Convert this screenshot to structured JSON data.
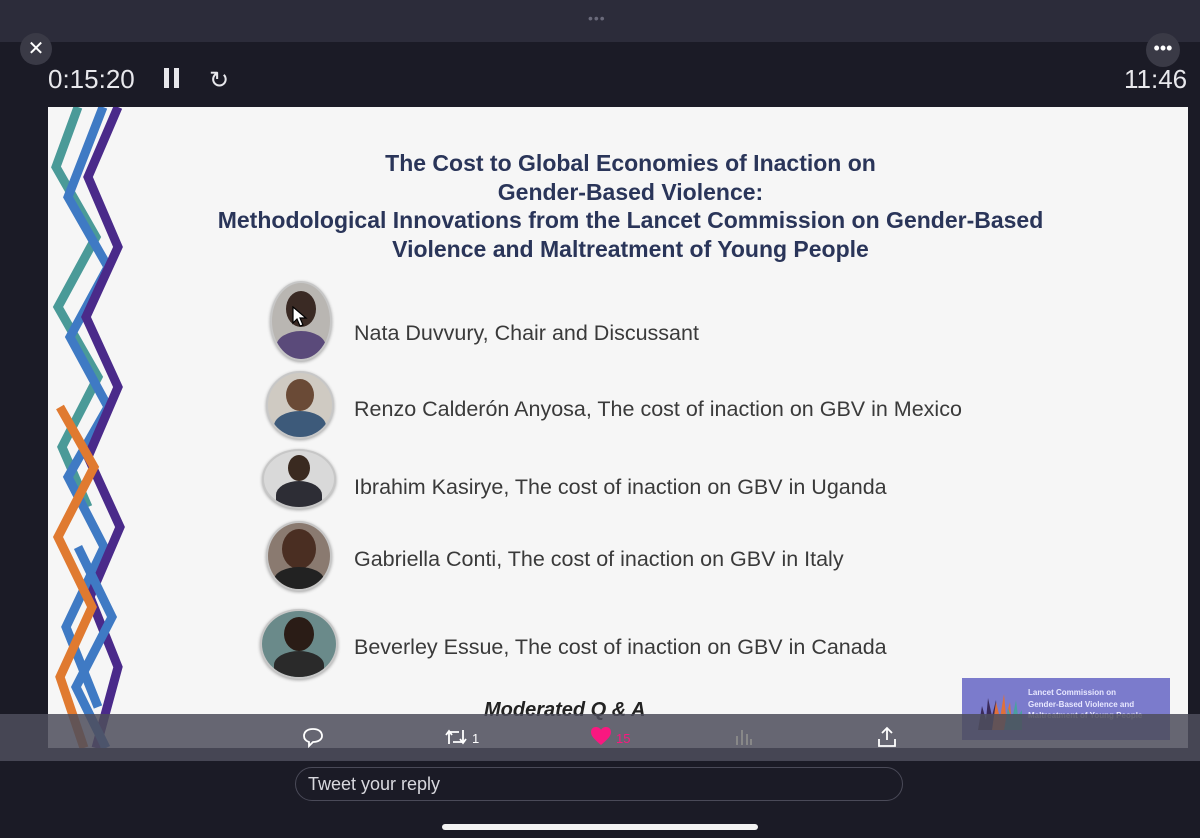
{
  "player": {
    "elapsed": "0:15:20",
    "duration": "11:46",
    "close_icon": "close-icon",
    "more_icon": "more-horizontal-icon",
    "pause_icon": "pause-icon",
    "replay_icon": "replay-icon"
  },
  "slide": {
    "title_lines": [
      "The Cost to Global Economies of Inaction on",
      "Gender-Based Violence:",
      "Methodological Innovations from the Lancet Commission on Gender-Based",
      "Violence and Maltreatment of Young People"
    ],
    "speakers": [
      {
        "text": "Nata Duvvury, Chair and Discussant"
      },
      {
        "text": "Renzo Calderón Anyosa, The cost of inaction on GBV in Mexico"
      },
      {
        "text": "Ibrahim Kasirye, The cost of inaction on GBV in Uganda"
      },
      {
        "text": "Gabriella Conti, The cost of inaction on GBV in Italy"
      },
      {
        "text": "Beverley Essue, The cost of inaction on GBV in Canada"
      }
    ],
    "moderated": "Moderated Q & A",
    "logo": {
      "lines": [
        "Lancet Commission on",
        "Gender-Based Violence and",
        "Maltreatment of Young People"
      ],
      "color": "#7b7bcc"
    },
    "title_color": "#2a3559"
  },
  "actions": {
    "reply_icon": "reply-icon",
    "retweet_icon": "retweet-icon",
    "retweet_count": "1",
    "like_icon": "heart-icon",
    "like_count": "15",
    "like_color": "#f91880",
    "analytics_icon": "analytics-icon",
    "share_icon": "share-icon"
  },
  "reply": {
    "placeholder": "Tweet your reply"
  }
}
